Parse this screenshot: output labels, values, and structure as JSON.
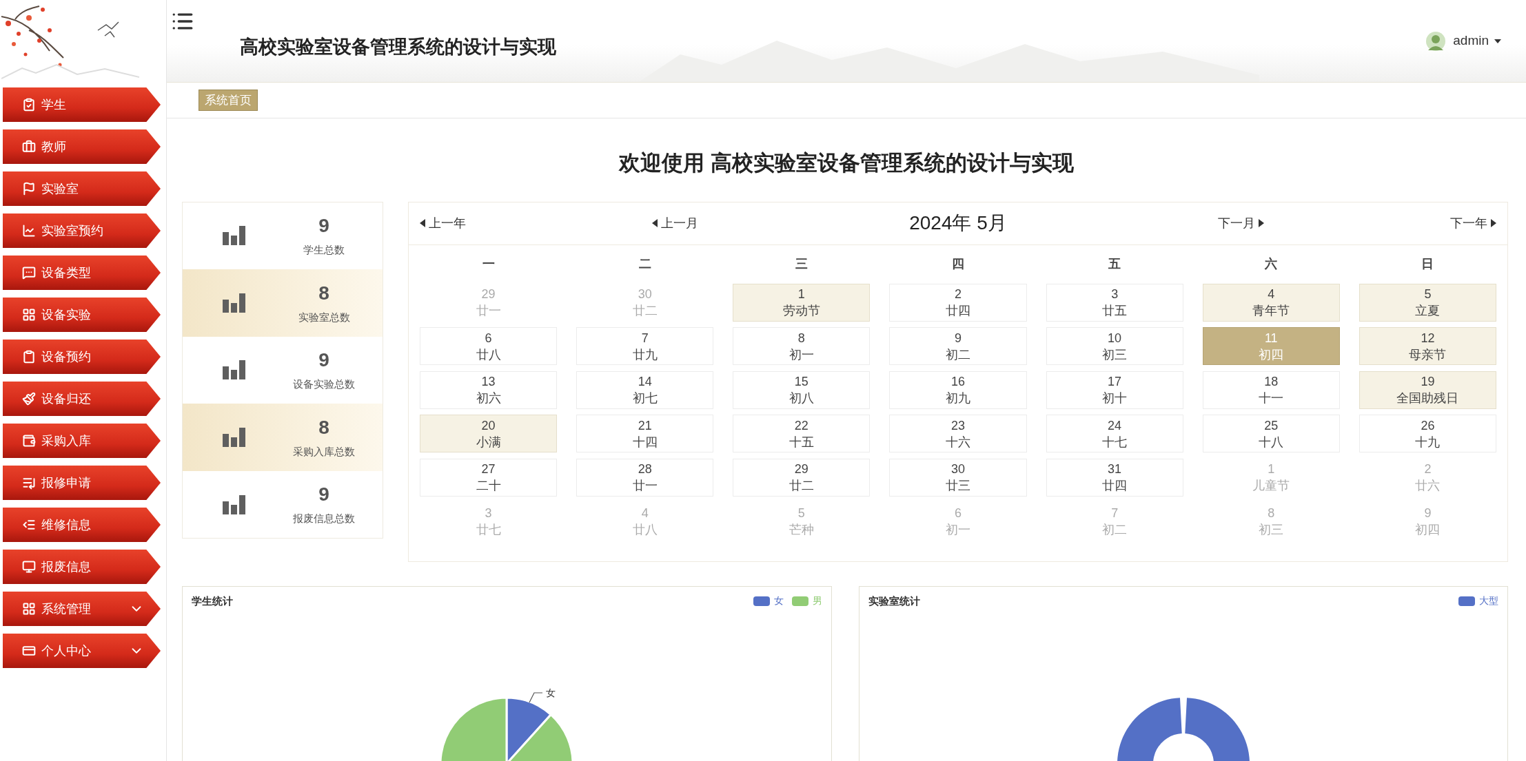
{
  "header": {
    "title": "高校实验室设备管理系统的设计与实现",
    "user": "admin"
  },
  "sidebar": {
    "items": [
      {
        "label": "学生",
        "kind": "link"
      },
      {
        "label": "教师",
        "kind": "link"
      },
      {
        "label": "实验室",
        "kind": "link"
      },
      {
        "label": "实验室预约",
        "kind": "link"
      },
      {
        "label": "设备类型",
        "kind": "link"
      },
      {
        "label": "设备实验",
        "kind": "link"
      },
      {
        "label": "设备预约",
        "kind": "link"
      },
      {
        "label": "设备归还",
        "kind": "link"
      },
      {
        "label": "采购入库",
        "kind": "link"
      },
      {
        "label": "报修申请",
        "kind": "link"
      },
      {
        "label": "维修信息",
        "kind": "link"
      },
      {
        "label": "报废信息",
        "kind": "link"
      },
      {
        "label": "系统管理",
        "kind": "group",
        "expanded": false
      },
      {
        "label": "个人中心",
        "kind": "group",
        "expanded": false
      }
    ]
  },
  "breadcrumb": "系统首页",
  "welcome": "欢迎使用 高校实验室设备管理系统的设计与实现",
  "stats": [
    {
      "value": "9",
      "label": "学生总数"
    },
    {
      "value": "8",
      "label": "实验室总数"
    },
    {
      "value": "9",
      "label": "设备实验总数"
    },
    {
      "value": "8",
      "label": "采购入库总数"
    },
    {
      "value": "9",
      "label": "报废信息总数"
    }
  ],
  "calendar": {
    "prev_year": "上一年",
    "prev_month": "上一月",
    "title": "2024年 5月",
    "next_month": "下一月",
    "next_year": "下一年",
    "weekdays": [
      "一",
      "二",
      "三",
      "四",
      "五",
      "六",
      "日"
    ],
    "days": [
      {
        "day": "29",
        "lunar": "廿一",
        "in_month": false,
        "festival": false,
        "selected": false
      },
      {
        "day": "30",
        "lunar": "廿二",
        "in_month": false,
        "festival": false,
        "selected": false
      },
      {
        "day": "1",
        "lunar": "劳动节",
        "in_month": true,
        "festival": true,
        "selected": false
      },
      {
        "day": "2",
        "lunar": "廿四",
        "in_month": true,
        "festival": false,
        "selected": false
      },
      {
        "day": "3",
        "lunar": "廿五",
        "in_month": true,
        "festival": false,
        "selected": false
      },
      {
        "day": "4",
        "lunar": "青年节",
        "in_month": true,
        "festival": true,
        "selected": false
      },
      {
        "day": "5",
        "lunar": "立夏",
        "in_month": true,
        "festival": true,
        "selected": false
      },
      {
        "day": "6",
        "lunar": "廿八",
        "in_month": true,
        "festival": false,
        "selected": false
      },
      {
        "day": "7",
        "lunar": "廿九",
        "in_month": true,
        "festival": false,
        "selected": false
      },
      {
        "day": "8",
        "lunar": "初一",
        "in_month": true,
        "festival": false,
        "selected": false
      },
      {
        "day": "9",
        "lunar": "初二",
        "in_month": true,
        "festival": false,
        "selected": false
      },
      {
        "day": "10",
        "lunar": "初三",
        "in_month": true,
        "festival": false,
        "selected": false
      },
      {
        "day": "11",
        "lunar": "初四",
        "in_month": true,
        "festival": false,
        "selected": true
      },
      {
        "day": "12",
        "lunar": "母亲节",
        "in_month": true,
        "festival": true,
        "selected": false
      },
      {
        "day": "13",
        "lunar": "初六",
        "in_month": true,
        "festival": false,
        "selected": false
      },
      {
        "day": "14",
        "lunar": "初七",
        "in_month": true,
        "festival": false,
        "selected": false
      },
      {
        "day": "15",
        "lunar": "初八",
        "in_month": true,
        "festival": false,
        "selected": false
      },
      {
        "day": "16",
        "lunar": "初九",
        "in_month": true,
        "festival": false,
        "selected": false
      },
      {
        "day": "17",
        "lunar": "初十",
        "in_month": true,
        "festival": false,
        "selected": false
      },
      {
        "day": "18",
        "lunar": "十一",
        "in_month": true,
        "festival": false,
        "selected": false
      },
      {
        "day": "19",
        "lunar": "全国助残日",
        "in_month": true,
        "festival": true,
        "selected": false
      },
      {
        "day": "20",
        "lunar": "小满",
        "in_month": true,
        "festival": true,
        "selected": false
      },
      {
        "day": "21",
        "lunar": "十四",
        "in_month": true,
        "festival": false,
        "selected": false
      },
      {
        "day": "22",
        "lunar": "十五",
        "in_month": true,
        "festival": false,
        "selected": false
      },
      {
        "day": "23",
        "lunar": "十六",
        "in_month": true,
        "festival": false,
        "selected": false
      },
      {
        "day": "24",
        "lunar": "十七",
        "in_month": true,
        "festival": false,
        "selected": false
      },
      {
        "day": "25",
        "lunar": "十八",
        "in_month": true,
        "festival": false,
        "selected": false
      },
      {
        "day": "26",
        "lunar": "十九",
        "in_month": true,
        "festival": false,
        "selected": false
      },
      {
        "day": "27",
        "lunar": "二十",
        "in_month": true,
        "festival": false,
        "selected": false
      },
      {
        "day": "28",
        "lunar": "廿一",
        "in_month": true,
        "festival": false,
        "selected": false
      },
      {
        "day": "29",
        "lunar": "廿二",
        "in_month": true,
        "festival": false,
        "selected": false
      },
      {
        "day": "30",
        "lunar": "廿三",
        "in_month": true,
        "festival": false,
        "selected": false
      },
      {
        "day": "31",
        "lunar": "廿四",
        "in_month": true,
        "festival": false,
        "selected": false
      },
      {
        "day": "1",
        "lunar": "儿童节",
        "in_month": false,
        "festival": false,
        "selected": false
      },
      {
        "day": "2",
        "lunar": "廿六",
        "in_month": false,
        "festival": false,
        "selected": false
      },
      {
        "day": "3",
        "lunar": "廿七",
        "in_month": false,
        "festival": false,
        "selected": false
      },
      {
        "day": "4",
        "lunar": "廿八",
        "in_month": false,
        "festival": false,
        "selected": false
      },
      {
        "day": "5",
        "lunar": "芒种",
        "in_month": false,
        "festival": false,
        "selected": false
      },
      {
        "day": "6",
        "lunar": "初一",
        "in_month": false,
        "festival": false,
        "selected": false
      },
      {
        "day": "7",
        "lunar": "初二",
        "in_month": false,
        "festival": false,
        "selected": false
      },
      {
        "day": "8",
        "lunar": "初三",
        "in_month": false,
        "festival": false,
        "selected": false
      },
      {
        "day": "9",
        "lunar": "初四",
        "in_month": false,
        "festival": false,
        "selected": false
      }
    ]
  },
  "charts": [
    {
      "title": "学生统计",
      "kind": "pie",
      "legend": [
        {
          "label": "女",
          "color": "#5470c6"
        },
        {
          "label": "男",
          "color": "#91cc75"
        }
      ],
      "slice_label": "女"
    },
    {
      "title": "实验室统计",
      "kind": "donut",
      "legend": [
        {
          "label": "大型",
          "color": "#5470c6"
        }
      ]
    }
  ]
}
